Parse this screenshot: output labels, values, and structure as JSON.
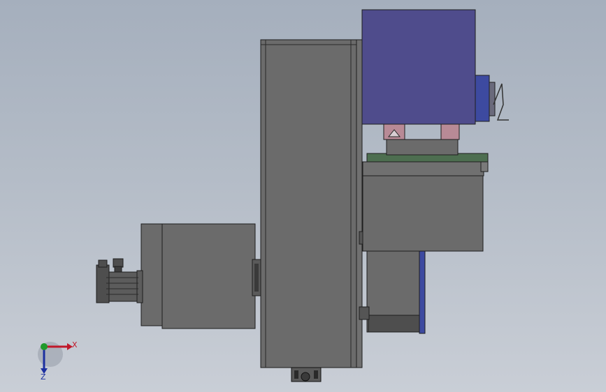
{
  "axes": {
    "x_label": "X",
    "z_label": "Z"
  },
  "colors": {
    "steel": "#6b6b6b",
    "steel_dark": "#4e4e4e",
    "motor_blue": "#4f4c8c",
    "bracket_blue": "#3d4aa0",
    "plate_green": "#4d6e50",
    "pad_pink": "#b88a96",
    "axis_x": "#c0182a",
    "axis_y": "#1f9a2a",
    "axis_z": "#1c2fa0"
  }
}
